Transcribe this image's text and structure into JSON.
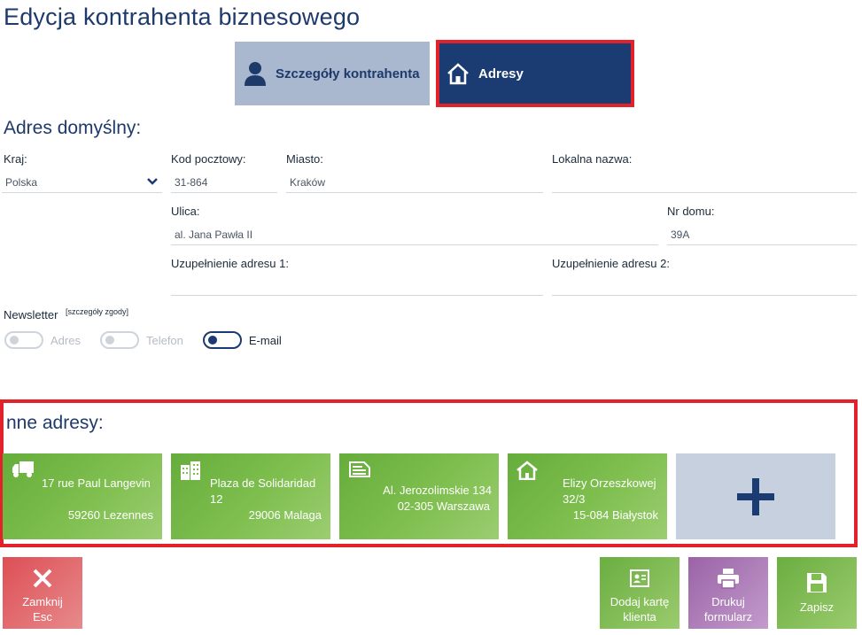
{
  "header": {
    "title": "Edycja kontrahenta biznesowego"
  },
  "tabs": {
    "details": "Szczegóły kontrahenta",
    "addresses": "Adresy"
  },
  "default_address": {
    "title": "Adres domyślny:",
    "country": {
      "label": "Kraj:",
      "value": "Polska"
    },
    "postal_code": {
      "label": "Kod pocztowy:",
      "value": "31-864"
    },
    "city": {
      "label": "Miasto:",
      "value": "Kraków"
    },
    "local_name": {
      "label": "Lokalna nazwa:",
      "value": ""
    },
    "street": {
      "label": "Ulica:",
      "value": "al. Jana Pawła II"
    },
    "house_no": {
      "label": "Nr domu:",
      "value": "39A"
    },
    "address_ext1": {
      "label": "Uzupełnienie adresu 1:",
      "value": ""
    },
    "address_ext2": {
      "label": "Uzupełnienie adresu 2:",
      "value": ""
    }
  },
  "newsletter": {
    "label": "Newsletter",
    "consent_link": "[szczegóły zgody]",
    "options": [
      {
        "label": "Adres",
        "checked": false
      },
      {
        "label": "Telefon",
        "checked": false
      },
      {
        "label": "E-mail",
        "checked": true
      }
    ]
  },
  "other_addresses": {
    "title": "nne adresy:",
    "cards": [
      {
        "icon": "truck-icon",
        "line1": "17 rue Paul Langevin",
        "line2": "59260 Lezennes"
      },
      {
        "icon": "building-icon",
        "line1": "Plaza de Solidaridad 12",
        "line2": "29006 Malaga"
      },
      {
        "icon": "invoice-icon",
        "line1": "Al. Jerozolimskie 134",
        "line2": "02-305 Warszawa"
      },
      {
        "icon": "house-icon",
        "line1": "Elizy Orzeszkowej 32/3",
        "line2": "15-084 Białystok"
      }
    ]
  },
  "buttons": {
    "close_label": "Zamknij",
    "close_shortcut": "Esc",
    "add_card_line1": "Dodaj kartę",
    "add_card_line2": "klienta",
    "print_line1": "Drukuj",
    "print_line2": "formularz",
    "save_label": "Zapisz"
  },
  "colors": {
    "primary": "#1a3c73",
    "highlight": "#e1222a",
    "green": "#7fbf4f",
    "red": "#dd4f55",
    "purple": "#9a63a6"
  }
}
